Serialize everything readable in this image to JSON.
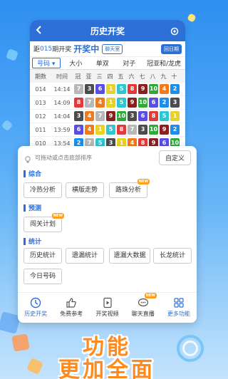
{
  "colors": {
    "accent": "#2c6fd6",
    "new_badge": "#ff9f1c",
    "slogan": "#ff8a1e"
  },
  "header": {
    "title": "历史开奖",
    "back_icon": "chevron-left-icon",
    "settings_icon": "gear-icon"
  },
  "period": {
    "prefix": "距",
    "issue": "015",
    "suffix": "期开奖",
    "status": "开奖中",
    "chat_button": "聊天室",
    "back_button": "回日期"
  },
  "tabs": [
    "号码",
    "大小",
    "单双",
    "对子",
    "冠亚和/龙虎"
  ],
  "table": {
    "headers": [
      "期数",
      "时间",
      "冠",
      "亚",
      "三",
      "四",
      "五",
      "六",
      "七",
      "八",
      "九",
      "十"
    ],
    "rows": [
      {
        "issue": "014",
        "time": "14:14",
        "balls": [
          "7",
          "3",
          "6",
          "1",
          "5",
          "8",
          "9",
          "10",
          "4",
          "2"
        ]
      },
      {
        "issue": "013",
        "time": "14:09",
        "balls": [
          "8",
          "7",
          "4",
          "1",
          "5",
          "9",
          "10",
          "6",
          "2",
          "3"
        ]
      },
      {
        "issue": "012",
        "time": "14:04",
        "balls": [
          "3",
          "4",
          "7",
          "9",
          "10",
          "3",
          "6",
          "8",
          "5",
          "1"
        ]
      },
      {
        "issue": "011",
        "time": "13:59",
        "balls": [
          "6",
          "4",
          "1",
          "5",
          "8",
          "7",
          "3",
          "10",
          "9",
          "2"
        ]
      },
      {
        "issue": "010",
        "time": "13:54",
        "balls": [
          "2",
          "7",
          "5",
          "3",
          "1",
          "4",
          "8",
          "9",
          "6",
          "10"
        ]
      }
    ]
  },
  "panel": {
    "hint": "可拖动或点击底部排序",
    "custom_button": "自定义",
    "sections": [
      {
        "title": "综合",
        "items": [
          {
            "label": "冷热分析",
            "new": false
          },
          {
            "label": "横版走势",
            "new": false
          },
          {
            "label": "路珠分析",
            "new": true
          }
        ]
      },
      {
        "title": "预测",
        "items": [
          {
            "label": "闯关计划",
            "new": true
          }
        ]
      },
      {
        "title": "统计",
        "items": [
          {
            "label": "历史统计",
            "new": false
          },
          {
            "label": "遗漏统计",
            "new": false
          },
          {
            "label": "遗漏大数据",
            "new": false
          },
          {
            "label": "长龙统计",
            "new": false
          },
          {
            "label": "今日号码",
            "new": false
          }
        ]
      }
    ],
    "new_badge": "NEW"
  },
  "bottom_nav": [
    {
      "label": "历史开奖",
      "icon": "clock-icon",
      "active": true,
      "new": false
    },
    {
      "label": "免费参考",
      "icon": "thumbs-up-icon",
      "active": false,
      "new": false
    },
    {
      "label": "开奖视频",
      "icon": "play-icon",
      "active": false,
      "new": false
    },
    {
      "label": "聊天直播",
      "icon": "chat-icon",
      "active": false,
      "new": true
    },
    {
      "label": "更多功能",
      "icon": "grid-icon",
      "active": true,
      "new": false
    }
  ],
  "slogan": {
    "line1": "功能",
    "line2": "更加全面"
  }
}
